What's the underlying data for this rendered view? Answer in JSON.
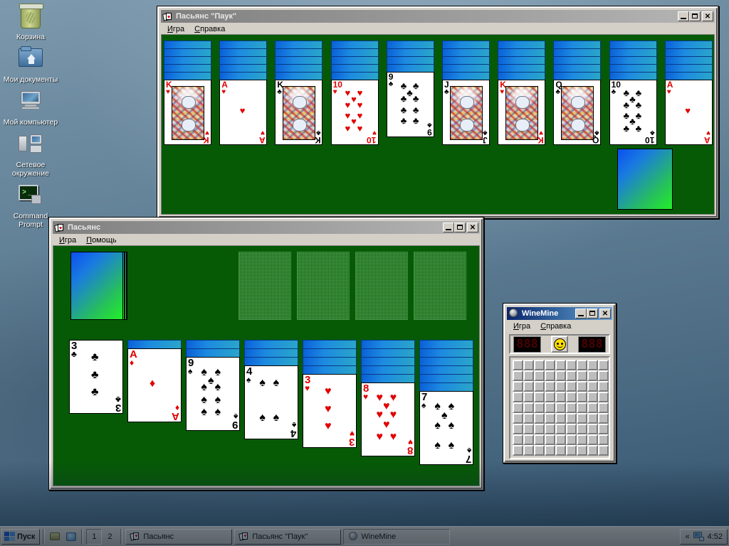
{
  "desktop": {
    "icons": [
      {
        "label": "Корзина",
        "icon": "recycle-bin-icon"
      },
      {
        "label": "Мои\nдокументы",
        "icon": "my-documents-folder-icon"
      },
      {
        "label": "Мой\nкомпьютер",
        "icon": "my-computer-icon"
      },
      {
        "label": "Сетевое\nокружение",
        "icon": "network-neighborhood-icon"
      },
      {
        "label": "Command\nPrompt",
        "icon": "command-prompt-icon"
      }
    ],
    "background_color": "#5d7b92"
  },
  "spider_window": {
    "title": "Пасьянс \"Паук\"",
    "icon": "spider-solitaire-icon",
    "active": false,
    "menus": [
      {
        "label": "Игра",
        "accel": "И"
      },
      {
        "label": "Справка",
        "accel": "С"
      }
    ],
    "buttons": {
      "minimize": "_",
      "maximize": "□",
      "close": "✕"
    },
    "felt_color": "#065a06",
    "columns": [
      {
        "facedown": 5,
        "rank": "K",
        "suit": "♥",
        "color": "red",
        "court": true
      },
      {
        "facedown": 5,
        "rank": "A",
        "suit": "♥",
        "color": "red",
        "court": false
      },
      {
        "facedown": 5,
        "rank": "K",
        "suit": "♣",
        "color": "black",
        "court": true
      },
      {
        "facedown": 5,
        "rank": "10",
        "suit": "♥",
        "color": "red",
        "court": false
      },
      {
        "facedown": 4,
        "rank": "9",
        "suit": "♣",
        "color": "black",
        "court": false
      },
      {
        "facedown": 5,
        "rank": "J",
        "suit": "♣",
        "color": "black",
        "court": true
      },
      {
        "facedown": 5,
        "rank": "K",
        "suit": "♥",
        "color": "red",
        "court": true
      },
      {
        "facedown": 5,
        "rank": "Q",
        "suit": "♣",
        "color": "black",
        "court": true
      },
      {
        "facedown": 5,
        "rank": "10",
        "suit": "♣",
        "color": "black",
        "court": false
      },
      {
        "facedown": 5,
        "rank": "A",
        "suit": "♥",
        "color": "red",
        "court": false
      }
    ],
    "stock_piles": 5,
    "card_back_colors": [
      "#0a4ff0",
      "#21f028"
    ]
  },
  "solitaire_window": {
    "title": "Пасьянс",
    "icon": "solitaire-icon",
    "active": false,
    "menus": [
      {
        "label": "Игра",
        "accel": "И"
      },
      {
        "label": "Помощь",
        "accel": "П"
      }
    ],
    "buttons": {
      "minimize": "_",
      "maximize": "□",
      "close": "✕"
    },
    "felt_color": "#065a06",
    "stock_depth": 4,
    "foundations": 4,
    "tableau": [
      {
        "facedown": 0,
        "rank": "3",
        "suit": "♣",
        "color": "black"
      },
      {
        "facedown": 1,
        "rank": "A",
        "suit": "♦",
        "color": "red"
      },
      {
        "facedown": 2,
        "rank": "9",
        "suit": "♠",
        "color": "black"
      },
      {
        "facedown": 3,
        "rank": "4",
        "suit": "♠",
        "color": "black"
      },
      {
        "facedown": 4,
        "rank": "3",
        "suit": "♥",
        "color": "red"
      },
      {
        "facedown": 5,
        "rank": "8",
        "suit": "♥",
        "color": "red"
      },
      {
        "facedown": 6,
        "rank": "7",
        "suit": "♠",
        "color": "black"
      }
    ]
  },
  "minesweeper_window": {
    "title": "WineMine",
    "icon": "winemine-icon",
    "active": true,
    "menus": [
      {
        "label": "Игра",
        "accel": "И"
      },
      {
        "label": "Справка",
        "accel": "С"
      }
    ],
    "buttons": {
      "minimize": "_",
      "maximize": "□",
      "close": "✕"
    },
    "mine_counter": "888",
    "timer": "888",
    "smiley": "smiley-face",
    "grid": {
      "cols": 9,
      "rows": 9
    }
  },
  "taskbar": {
    "start_label": "Пуск",
    "quicklaunch": [
      {
        "name": "quicklaunch-icon-1"
      },
      {
        "name": "quicklaunch-icon-2"
      }
    ],
    "desktops": [
      {
        "label": "1",
        "active": true
      },
      {
        "label": "2",
        "active": false
      }
    ],
    "tasks": [
      {
        "label": "Пасьянс",
        "icon": "solitaire-icon",
        "pressed": false
      },
      {
        "label": "Пасьянс \"Паук\"",
        "icon": "spider-solitaire-icon",
        "pressed": false
      },
      {
        "label": "WineMine",
        "icon": "winemine-icon",
        "pressed": true
      }
    ],
    "tray": {
      "chevron": "«",
      "network_icon": "network-tray-icon",
      "clock": "4:52"
    }
  }
}
